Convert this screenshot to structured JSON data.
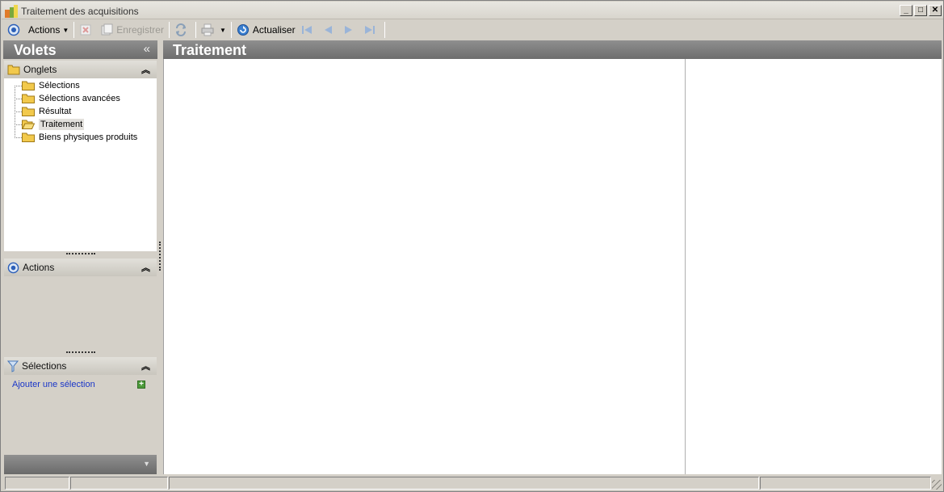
{
  "window": {
    "title": "Traitement des acquisitions",
    "controls": {
      "minimize": "_",
      "maximize": "□",
      "close": "✕"
    }
  },
  "toolbar": {
    "actions_label": "Actions",
    "save_label": "Enregistrer",
    "refresh_label": "Actualiser"
  },
  "left_pane": {
    "title": "Volets",
    "collapse_glyph": "«",
    "onglets": {
      "title": "Onglets",
      "items": [
        {
          "label": "Sélections",
          "selected": false
        },
        {
          "label": "Sélections avancées",
          "selected": false
        },
        {
          "label": "Résultat",
          "selected": false
        },
        {
          "label": "Traitement",
          "selected": true
        },
        {
          "label": "Biens physiques produits",
          "selected": false
        }
      ]
    },
    "actions": {
      "title": "Actions"
    },
    "selections": {
      "title": "Sélections",
      "add_link": "Ajouter une sélection"
    }
  },
  "main": {
    "title": "Traitement"
  },
  "colors": {
    "header_gradient_top": "#8f8f8f",
    "header_gradient_bottom": "#6d6d6d",
    "link": "#1a36c8",
    "folder": "#f2c94c"
  },
  "icons": [
    "app-icon",
    "actions-icon",
    "delete-icon",
    "save-icon",
    "sync-icon",
    "print-icon",
    "refresh-icon",
    "first-icon",
    "prev-icon",
    "next-icon",
    "last-icon",
    "folder-icon",
    "filter-icon",
    "add-icon"
  ]
}
